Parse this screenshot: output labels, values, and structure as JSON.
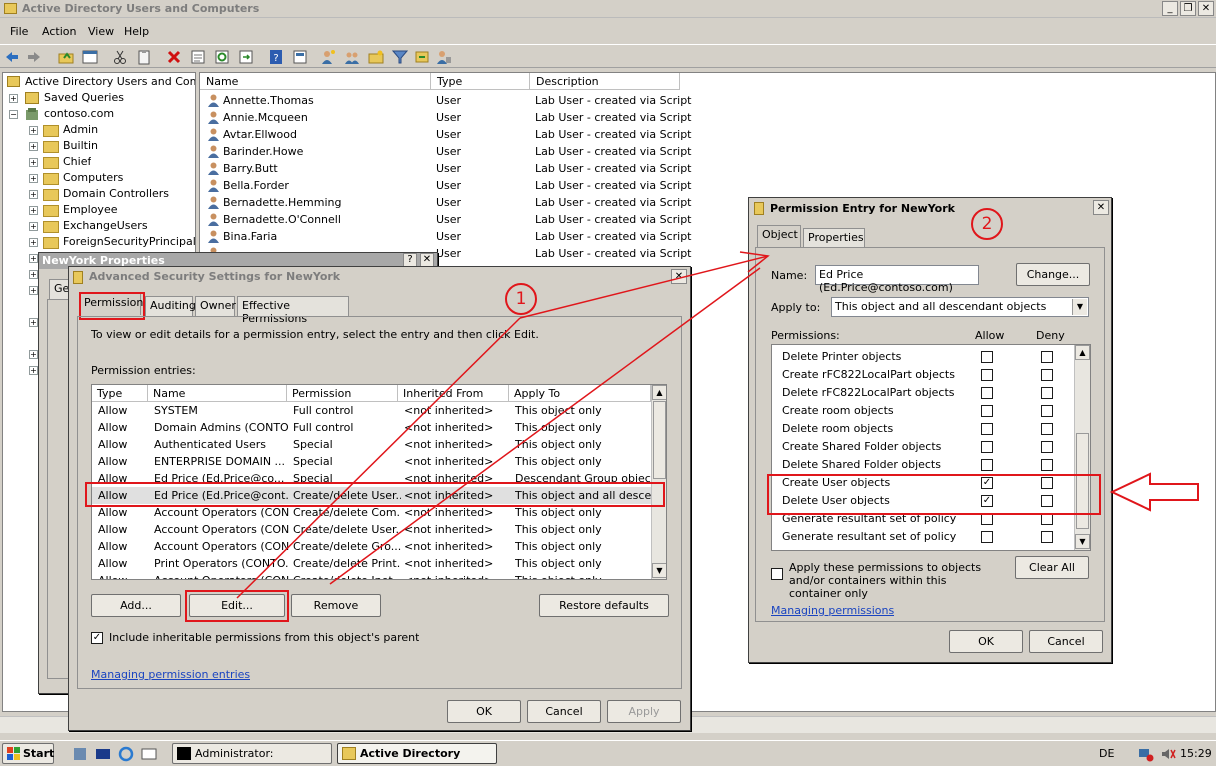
{
  "window": {
    "title": "Active Directory Users and Computers",
    "min_label": "_",
    "max_label": "❐",
    "close_label": "✕"
  },
  "menu": [
    "File",
    "Action",
    "View",
    "Help"
  ],
  "tree": {
    "root": "Active Directory Users and Computers",
    "saved_queries": "Saved Queries",
    "domain": "contoso.com",
    "ous": [
      "Admin",
      "Builtin",
      "Chief",
      "Computers",
      "Domain Controllers",
      "Employee",
      "ExchangeUsers",
      "ForeignSecurityPrincipals"
    ]
  },
  "list": {
    "columns": [
      "Name",
      "Type",
      "Description"
    ],
    "rows": [
      [
        "Annette.Thomas",
        "User",
        "Lab User - created via Script"
      ],
      [
        "Annie.Mcqueen",
        "User",
        "Lab User - created via Script"
      ],
      [
        "Avtar.Ellwood",
        "User",
        "Lab User - created via Script"
      ],
      [
        "Barinder.Howe",
        "User",
        "Lab User - created via Script"
      ],
      [
        "Barry.Butt",
        "User",
        "Lab User - created via Script"
      ],
      [
        "Bella.Forder",
        "User",
        "Lab User - created via Script"
      ],
      [
        "Bernadette.Hemming",
        "User",
        "Lab User - created via Script"
      ],
      [
        "Bernadette.O'Connell",
        "User",
        "Lab User - created via Script"
      ],
      [
        "Bina.Faria",
        "User",
        "Lab User - created via Script"
      ],
      [
        "",
        "User",
        "Lab User - created via Script"
      ]
    ]
  },
  "props_dialog": {
    "title": "NewYork Properties",
    "tab_partial": "Ge"
  },
  "adv": {
    "title": "Advanced Security Settings for NewYork",
    "tabs": [
      "Permissions",
      "Auditing",
      "Owner",
      "Effective Permissions"
    ],
    "instructions": "To view or edit details for a permission entry, select the entry and then click Edit.",
    "entries_label": "Permission entries:",
    "columns": [
      "Type",
      "Name",
      "Permission",
      "Inherited From",
      "Apply To"
    ],
    "rows": [
      [
        "Allow",
        "SYSTEM",
        "Full control",
        "<not inherited>",
        "This object only"
      ],
      [
        "Allow",
        "Domain Admins (CONTO...",
        "Full control",
        "<not inherited>",
        "This object only"
      ],
      [
        "Allow",
        "Authenticated Users",
        "Special",
        "<not inherited>",
        "This object only"
      ],
      [
        "Allow",
        "ENTERPRISE DOMAIN ...",
        "Special",
        "<not inherited>",
        "This object only"
      ],
      [
        "Allow",
        "Ed Price (Ed.Price@co...",
        "Special",
        "<not inherited>",
        "Descendant Group objects"
      ],
      [
        "Allow",
        "Ed Price (Ed.Price@cont...",
        "Create/delete User...",
        "<not inherited>",
        "This object and all desce..."
      ],
      [
        "Allow",
        "Account Operators (CON...",
        "Create/delete Com...",
        "<not inherited>",
        "This object only"
      ],
      [
        "Allow",
        "Account Operators (CON...",
        "Create/delete User...",
        "<not inherited>",
        "This object only"
      ],
      [
        "Allow",
        "Account Operators (CON...",
        "Create/delete Gro...",
        "<not inherited>",
        "This object only"
      ],
      [
        "Allow",
        "Print Operators (CONTO...",
        "Create/delete Print...",
        "<not inherited>",
        "This object only"
      ],
      [
        "Allow",
        "Account Operators (CON...",
        "Create/delete Inet...",
        "<not inherited>",
        "This object only"
      ]
    ],
    "add": "Add...",
    "edit": "Edit...",
    "remove": "Remove",
    "restore": "Restore defaults",
    "include_inheritable": "Include inheritable permissions from this object's parent",
    "include_checked": true,
    "link": "Managing permission entries",
    "ok": "OK",
    "cancel": "Cancel",
    "apply": "Apply",
    "badge": "1"
  },
  "perm": {
    "title": "Permission Entry for NewYork",
    "tabs": [
      "Object",
      "Properties"
    ],
    "name_label": "Name:",
    "name_value": "Ed Price (Ed.Price@contoso.com)",
    "change": "Change...",
    "apply_to_label": "Apply to:",
    "apply_to_value": "This object and all descendant objects",
    "permissions_label": "Permissions:",
    "allow_label": "Allow",
    "deny_label": "Deny",
    "rows": [
      {
        "label": "Delete Printer objects",
        "allow": false,
        "deny": false
      },
      {
        "label": "Create rFC822LocalPart objects",
        "allow": false,
        "deny": false
      },
      {
        "label": "Delete rFC822LocalPart objects",
        "allow": false,
        "deny": false
      },
      {
        "label": "Create room objects",
        "allow": false,
        "deny": false
      },
      {
        "label": "Delete room objects",
        "allow": false,
        "deny": false
      },
      {
        "label": "Create Shared Folder objects",
        "allow": false,
        "deny": false
      },
      {
        "label": "Delete Shared Folder objects",
        "allow": false,
        "deny": false
      },
      {
        "label": "Create User objects",
        "allow": true,
        "deny": false
      },
      {
        "label": "Delete User objects",
        "allow": true,
        "deny": false
      },
      {
        "label": "Generate resultant set of policy",
        "allow": false,
        "deny": false
      },
      {
        "label": "Generate resultant set of policy",
        "allow": false,
        "deny": false
      }
    ],
    "apply_check": "Apply these permissions to objects and/or containers within this container only",
    "clear_all": "Clear All",
    "link": "Managing permissions",
    "ok": "OK",
    "cancel": "Cancel",
    "badge": "2"
  },
  "taskbar": {
    "start": "Start",
    "tasks": [
      "Administrator: Command...",
      "Active Directory User..."
    ],
    "lang": "DE",
    "time": "15:29"
  },
  "colors": {
    "annotation_red": "#e0161b",
    "link_blue": "#1a44c0",
    "selection": "#e0e0e0"
  }
}
